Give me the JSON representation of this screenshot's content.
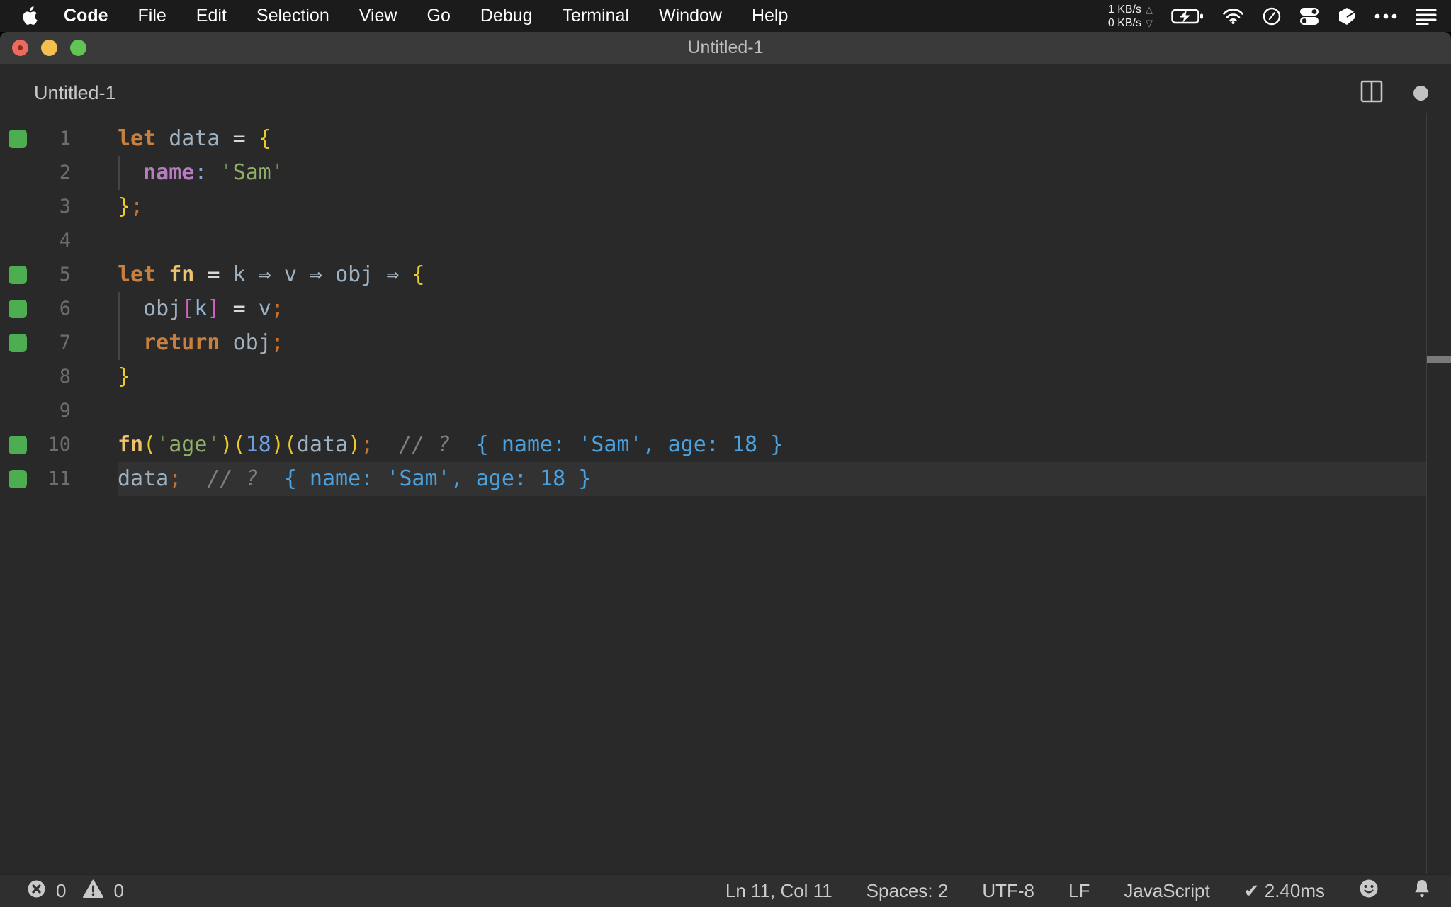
{
  "menu_bar": {
    "app_menu": "Code",
    "items": [
      "File",
      "Edit",
      "Selection",
      "View",
      "Go",
      "Debug",
      "Terminal",
      "Window",
      "Help"
    ],
    "network": {
      "up": "1 KB/s",
      "down": "0 KB/s",
      "up_arrow": "△",
      "down_arrow": "▽"
    }
  },
  "window": {
    "title": "Untitled-1"
  },
  "editor_header": {
    "tab_title": "Untitled-1"
  },
  "editor": {
    "language": "JavaScript",
    "marker_color": "#4cae51",
    "output_color": "#4ba2de",
    "lines": [
      {
        "num": "1",
        "marker": true,
        "guide": false,
        "current": false,
        "tokens": [
          {
            "t": "let",
            "c": "kw"
          },
          {
            "t": " "
          },
          {
            "t": "data",
            "c": "id"
          },
          {
            "t": " "
          },
          {
            "t": "=",
            "c": "op"
          },
          {
            "t": " "
          },
          {
            "t": "{",
            "c": "br"
          }
        ]
      },
      {
        "num": "2",
        "marker": false,
        "guide": true,
        "current": false,
        "tokens": [
          {
            "t": "  "
          },
          {
            "t": "name",
            "c": "prop"
          },
          {
            "t": ":",
            "c": "colon"
          },
          {
            "t": " "
          },
          {
            "t": "'",
            "c": "strq"
          },
          {
            "t": "Sam",
            "c": "str"
          },
          {
            "t": "'",
            "c": "strq"
          }
        ]
      },
      {
        "num": "3",
        "marker": false,
        "guide": false,
        "current": false,
        "tokens": [
          {
            "t": "}",
            "c": "br"
          },
          {
            "t": ";",
            "c": "semi"
          }
        ]
      },
      {
        "num": "4",
        "marker": false,
        "guide": false,
        "current": false,
        "tokens": []
      },
      {
        "num": "5",
        "marker": true,
        "guide": false,
        "current": false,
        "tokens": [
          {
            "t": "let",
            "c": "kw"
          },
          {
            "t": " "
          },
          {
            "t": "fn",
            "c": "fn"
          },
          {
            "t": " "
          },
          {
            "t": "=",
            "c": "op"
          },
          {
            "t": " "
          },
          {
            "t": "k",
            "c": "id"
          },
          {
            "t": " "
          },
          {
            "t": "⇒",
            "c": "arrow"
          },
          {
            "t": " "
          },
          {
            "t": "v",
            "c": "id"
          },
          {
            "t": " "
          },
          {
            "t": "⇒",
            "c": "arrow"
          },
          {
            "t": " "
          },
          {
            "t": "obj",
            "c": "id"
          },
          {
            "t": " "
          },
          {
            "t": "⇒",
            "c": "arrow"
          },
          {
            "t": " "
          },
          {
            "t": "{",
            "c": "br"
          }
        ]
      },
      {
        "num": "6",
        "marker": true,
        "guide": true,
        "current": false,
        "tokens": [
          {
            "t": "  "
          },
          {
            "t": "obj",
            "c": "id"
          },
          {
            "t": "[",
            "c": "brk"
          },
          {
            "t": "k",
            "c": "id2"
          },
          {
            "t": "]",
            "c": "brk"
          },
          {
            "t": " "
          },
          {
            "t": "=",
            "c": "op"
          },
          {
            "t": " "
          },
          {
            "t": "v",
            "c": "id"
          },
          {
            "t": ";",
            "c": "semi"
          }
        ]
      },
      {
        "num": "7",
        "marker": true,
        "guide": true,
        "current": false,
        "tokens": [
          {
            "t": "  "
          },
          {
            "t": "return",
            "c": "kw"
          },
          {
            "t": " "
          },
          {
            "t": "obj",
            "c": "id"
          },
          {
            "t": ";",
            "c": "semi"
          }
        ]
      },
      {
        "num": "8",
        "marker": false,
        "guide": false,
        "current": false,
        "tokens": [
          {
            "t": "}",
            "c": "br"
          }
        ]
      },
      {
        "num": "9",
        "marker": false,
        "guide": false,
        "current": false,
        "tokens": []
      },
      {
        "num": "10",
        "marker": true,
        "guide": false,
        "current": false,
        "tokens": [
          {
            "t": "fn",
            "c": "fn"
          },
          {
            "t": "(",
            "c": "br"
          },
          {
            "t": "'",
            "c": "strq"
          },
          {
            "t": "age",
            "c": "str"
          },
          {
            "t": "'",
            "c": "strq"
          },
          {
            "t": ")",
            "c": "br"
          },
          {
            "t": "(",
            "c": "br"
          },
          {
            "t": "18",
            "c": "num"
          },
          {
            "t": ")",
            "c": "br"
          },
          {
            "t": "(",
            "c": "br"
          },
          {
            "t": "data",
            "c": "id"
          },
          {
            "t": ")",
            "c": "br"
          },
          {
            "t": ";",
            "c": "semi"
          },
          {
            "t": "  "
          },
          {
            "t": "// ?",
            "c": "cmt"
          },
          {
            "t": "  "
          },
          {
            "t": "{ name: 'Sam', age: 18 }",
            "c": "out"
          }
        ]
      },
      {
        "num": "11",
        "marker": true,
        "guide": false,
        "current": true,
        "tokens": [
          {
            "t": "data",
            "c": "id"
          },
          {
            "t": ";",
            "c": "semi"
          },
          {
            "t": "  "
          },
          {
            "t": "// ?",
            "c": "cmt"
          },
          {
            "t": "  "
          },
          {
            "t": "{ name: 'Sam', age: 18 }",
            "c": "out"
          }
        ]
      }
    ]
  },
  "status_bar": {
    "errors": "0",
    "warnings": "0",
    "cursor": "Ln 11, Col 11",
    "indent": "Spaces: 2",
    "encoding": "UTF-8",
    "eol": "LF",
    "language": "JavaScript",
    "perf": "✔ 2.40ms"
  }
}
